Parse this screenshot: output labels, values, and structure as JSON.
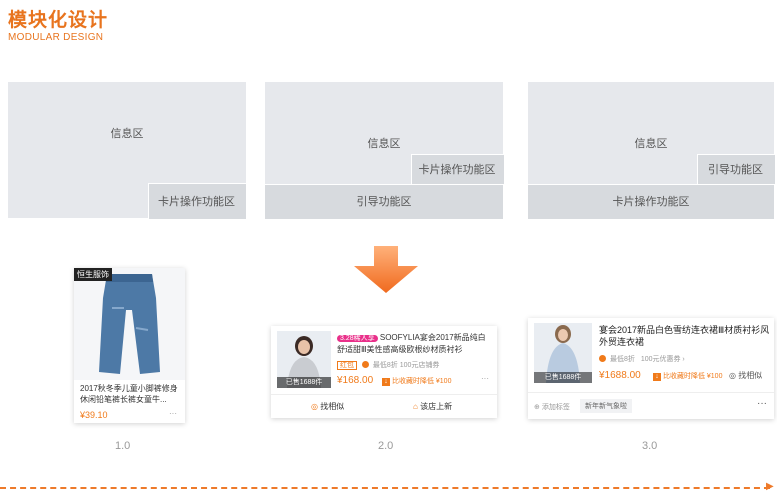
{
  "header": {
    "title": "模块化设计",
    "subtitle": "MODULAR DESIGN"
  },
  "layouts": [
    {
      "info": "信息区",
      "card_ops": "卡片操作功能区"
    },
    {
      "info": "信息区",
      "card_ops": "卡片操作功能区",
      "guide": "引导功能区"
    },
    {
      "info": "信息区",
      "guide": "引导功能区",
      "card_ops": "卡片操作功能区"
    }
  ],
  "cards": {
    "v1": {
      "badge": "恒生服饰",
      "title": "2017秋冬季儿童小脚裤修身休闲铅笔裤长裤女童牛...",
      "price": "¥39.10",
      "more": "···",
      "version": "1.0"
    },
    "v2": {
      "promo": "3.28稀人享",
      "title": "SOOFYLIA宴会2017新品纯白舒适甜Ⅲ美性感高级欧根纱材质衬衫",
      "tag": "红包",
      "coupon": "最低8折 100元店铺券",
      "sold": "已售1688件",
      "price": "¥168.00",
      "cut": "比收藏时降低 ¥100",
      "more": "···",
      "find_similar": "找相似",
      "go_store": "该店上新",
      "version": "2.0"
    },
    "v3": {
      "title": "宴会2017新品白色雪纺连衣裙Ⅲ材质衬衫风外贸连衣裙",
      "coupon": "最低8折",
      "coupon2": "100元优惠券 ›",
      "sold": "已售1688件",
      "price": "¥1688.00",
      "cut": "比收藏时降低 ¥100",
      "find_similar": "找相似",
      "add_tag": "添加标签",
      "tag_chip": "新年新气象啦",
      "more": "···",
      "version": "3.0"
    }
  },
  "colors": {
    "accent": "#e8741e",
    "zone": "#e6e8ec",
    "zone_dark": "#d7dade"
  }
}
